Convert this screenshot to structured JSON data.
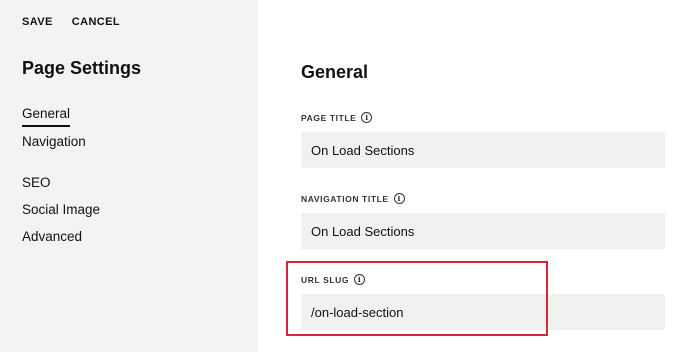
{
  "toolbar": {
    "save_label": "SAVE",
    "cancel_label": "CANCEL"
  },
  "sidebar": {
    "title": "Page Settings",
    "items": [
      {
        "label": "General",
        "active": true
      },
      {
        "label": "Navigation",
        "active": false
      },
      {
        "label": "SEO",
        "active": false
      },
      {
        "label": "Social Image",
        "active": false
      },
      {
        "label": "Advanced",
        "active": false
      }
    ]
  },
  "main": {
    "title": "General",
    "fields": [
      {
        "label": "PAGE TITLE",
        "value": "On Load Sections",
        "info_icon": "info-icon"
      },
      {
        "label": "NAVIGATION TITLE",
        "value": "On Load Sections",
        "info_icon": "info-icon"
      },
      {
        "label": "URL SLUG",
        "value": "/on-load-section",
        "info_icon": "info-icon"
      }
    ]
  },
  "colors": {
    "sidebar_bg": "#f3f3f3",
    "input_bg": "#f1f1f1",
    "highlight": "#d42a2f",
    "text": "#111111"
  }
}
